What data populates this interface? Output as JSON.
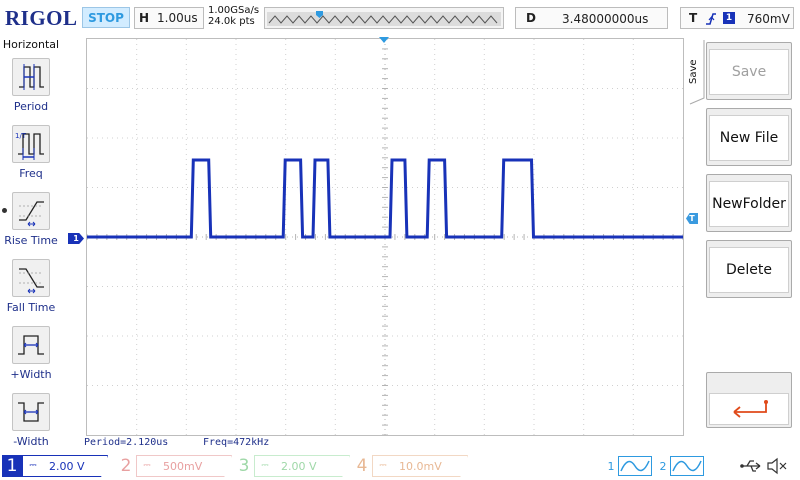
{
  "brand": "RIGOL",
  "run_state": "STOP",
  "timebase": {
    "key": "H",
    "value": "1.00us"
  },
  "sampling": {
    "rate": "1.00GSa/s",
    "points": "24.0k pts"
  },
  "delay": {
    "key": "D",
    "value": "3.48000000us"
  },
  "trigger": {
    "key": "T",
    "channel": "1",
    "level": "760mV"
  },
  "left_menu": {
    "title": "Horizontal",
    "items": [
      {
        "label": "Period",
        "icon": "period-icon"
      },
      {
        "label": "Freq",
        "icon": "frequency-icon"
      },
      {
        "label": "Rise Time",
        "icon": "rise-time-icon"
      },
      {
        "label": "Fall Time",
        "icon": "fall-time-icon"
      },
      {
        "label": "+Width",
        "icon": "positive-width-icon"
      },
      {
        "label": "-Width",
        "icon": "negative-width-icon"
      }
    ],
    "selected": "Rise Time"
  },
  "measurements": {
    "period": "Period=2.120us",
    "freq": "Freq=472kHz"
  },
  "right_menu": {
    "tab": "Save",
    "buttons": [
      {
        "label": "Save",
        "enabled": false
      },
      {
        "label": "New File",
        "enabled": true
      },
      {
        "label": "NewFolder",
        "enabled": true
      },
      {
        "label": "Delete",
        "enabled": true
      }
    ],
    "back_icon": "return-arrow-icon"
  },
  "channels": [
    {
      "num": "1",
      "coupling": "DC",
      "scale": "2.00 V",
      "active": true,
      "color": "#1832b8"
    },
    {
      "num": "2",
      "coupling": "DC",
      "scale": "500mV",
      "active": false,
      "color": "#e8a0a0"
    },
    {
      "num": "3",
      "coupling": "DC",
      "scale": "2.00 V",
      "active": false,
      "color": "#9fd8a8"
    },
    {
      "num": "4",
      "coupling": "DC",
      "scale": "10.0mV",
      "active": false,
      "color": "#e8b894"
    }
  ],
  "math": [
    {
      "num": "1"
    },
    {
      "num": "2"
    }
  ],
  "status_icons": [
    "usb-icon",
    "mute-icon"
  ],
  "ch1_marker": "1",
  "trigger_marker": "T",
  "colors": {
    "trace": "#1832b8",
    "accent": "#2e9ae0",
    "brand": "#1e2f8a",
    "trigger_arrow": "#e04a1a"
  },
  "waveform": {
    "time_unit": "us",
    "pulses": [
      {
        "start": 2.1,
        "end": 2.45
      },
      {
        "start": 3.95,
        "end": 4.3
      },
      {
        "start": 4.55,
        "end": 4.85
      },
      {
        "start": 6.1,
        "end": 6.4
      },
      {
        "start": 6.85,
        "end": 7.2
      },
      {
        "start": 8.35,
        "end": 8.95
      }
    ]
  }
}
